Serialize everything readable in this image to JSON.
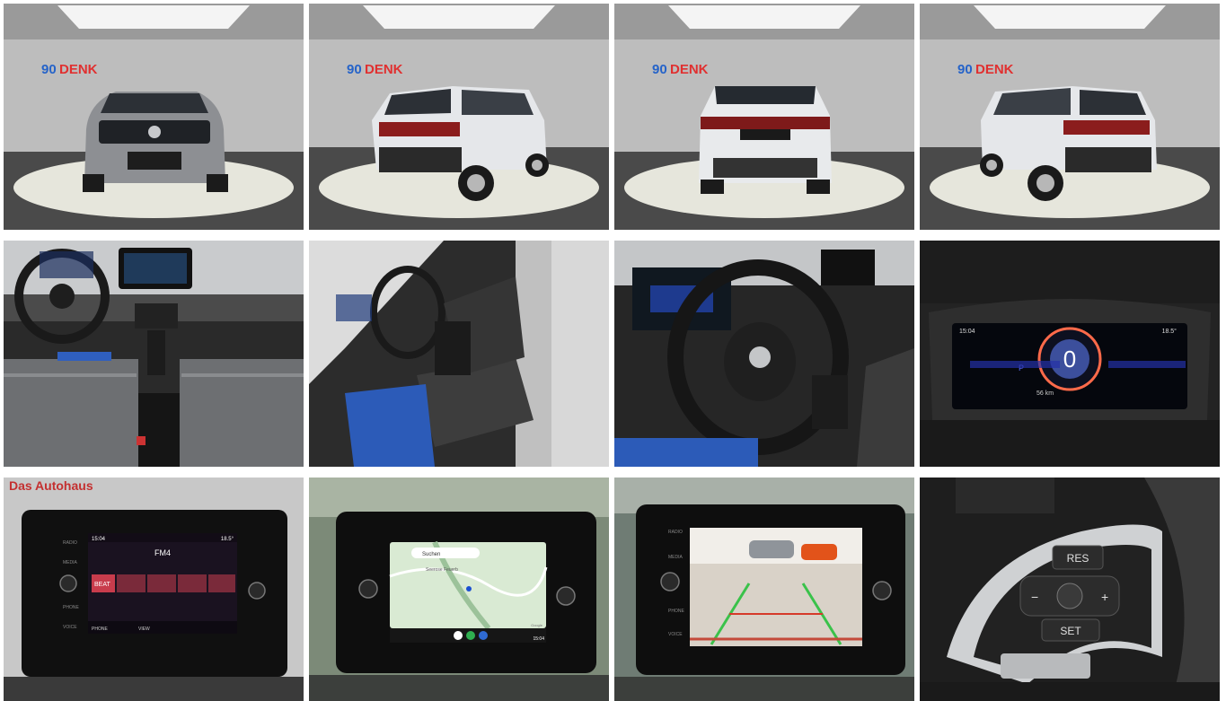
{
  "brand": {
    "logo_number": "90",
    "logo_name": "DENK",
    "logo_tagline": "Das Autohaus"
  },
  "photos": [
    {
      "label": "front-exterior"
    },
    {
      "label": "rear-three-quarter-right"
    },
    {
      "label": "rear-exterior"
    },
    {
      "label": "rear-three-quarter-left"
    },
    {
      "label": "dashboard-overview"
    },
    {
      "label": "front-seat-interior"
    },
    {
      "label": "steering-wheel-interior"
    },
    {
      "label": "digital-instrument-cluster"
    },
    {
      "label": "infotainment-radio"
    },
    {
      "label": "infotainment-navigation"
    },
    {
      "label": "rear-view-camera"
    },
    {
      "label": "steering-wheel-controls"
    }
  ],
  "cluster": {
    "time": "15:04",
    "temp": "18.5°",
    "speed": "0",
    "range": "56 km"
  },
  "radio": {
    "time": "15:04",
    "temp": "18.5°",
    "station": "FM4",
    "preset": "BEAT",
    "side_left": [
      "RADIO",
      "MEDIA",
      "PHONE",
      "VOICE"
    ],
    "bottom": [
      "PHONE",
      "VIEW"
    ]
  },
  "nav": {
    "search": "Suchen",
    "place": "Seerose Feuerb",
    "time": "15:04",
    "maps": "Google"
  },
  "camera": {
    "side_left": [
      "RADIO",
      "MEDIA",
      "PHONE",
      "VOICE"
    ]
  },
  "controls": {
    "res": "RES",
    "set": "SET",
    "minus": "−",
    "plus": "+"
  }
}
